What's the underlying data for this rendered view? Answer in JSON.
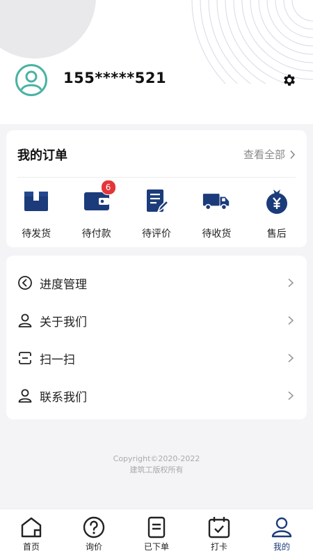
{
  "profile": {
    "phone": "155*****521"
  },
  "orders": {
    "title": "我的订单",
    "view_all": "查看全部",
    "items": [
      {
        "label": "待发货",
        "icon": "package-icon"
      },
      {
        "label": "待付款",
        "icon": "wallet-icon",
        "badge": "6"
      },
      {
        "label": "待评价",
        "icon": "review-icon"
      },
      {
        "label": "待收货",
        "icon": "truck-icon"
      },
      {
        "label": "售后",
        "icon": "money-bag-icon"
      }
    ]
  },
  "menu": [
    {
      "label": "进度管理",
      "icon": "progress-icon"
    },
    {
      "label": "关于我们",
      "icon": "person-icon"
    },
    {
      "label": "扫一扫",
      "icon": "scan-icon"
    },
    {
      "label": "联系我们",
      "icon": "person-icon"
    }
  ],
  "footer": {
    "line1": "Copyright©2020-2022",
    "line2": "建筑工版权所有"
  },
  "tabbar": [
    {
      "label": "首页",
      "icon": "home-icon"
    },
    {
      "label": "询价",
      "icon": "question-icon"
    },
    {
      "label": "已下单",
      "icon": "order-list-icon"
    },
    {
      "label": "打卡",
      "icon": "calendar-check-icon"
    },
    {
      "label": "我的",
      "icon": "profile-icon",
      "active": true
    }
  ],
  "colors": {
    "accent": "#1b3b7a",
    "avatar": "#4ab2a4",
    "badge": "#e3363a"
  }
}
